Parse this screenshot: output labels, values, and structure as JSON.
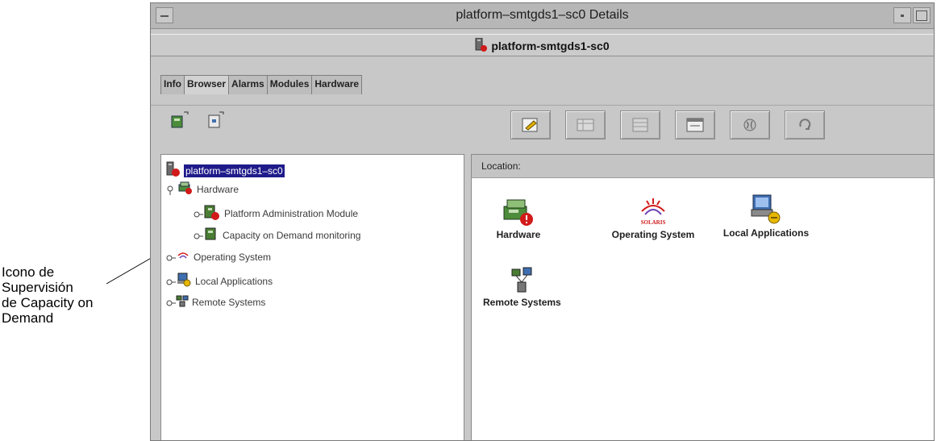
{
  "callout": {
    "line1": "Icono de",
    "line2": "Supervisión",
    "line3": "de Capacity on",
    "line4": "Demand"
  },
  "window": {
    "title": "platform–smtgds1–sc0 Details",
    "subtitle": "platform-smtgds1-sc0",
    "tabs": [
      "Info",
      "Browser",
      "Alarms",
      "Modules",
      "Hardware"
    ],
    "active_tab": "Browser",
    "toolbar_left": [
      "details-icon",
      "properties-icon"
    ],
    "toolbar_buttons": [
      "edit-icon",
      "table-icon",
      "grid-icon",
      "window-icon",
      "globe-icon",
      "refresh-icon"
    ]
  },
  "tree": {
    "root": "platform–smtgds1–sc0",
    "items": [
      "Hardware",
      "Platform Administration Module",
      "Capacity on Demand monitoring",
      "Operating System",
      "Local Applications",
      "Remote Systems"
    ]
  },
  "right": {
    "location_label": "Location:",
    "items": [
      "Hardware",
      "Operating System",
      "Local Applications",
      "Remote Systems"
    ],
    "solaris_text": "SOLARIS"
  },
  "colors": {
    "selection": "#1f1b8a",
    "alert": "#d11a1a",
    "window_bg": "#c8c8c8"
  }
}
